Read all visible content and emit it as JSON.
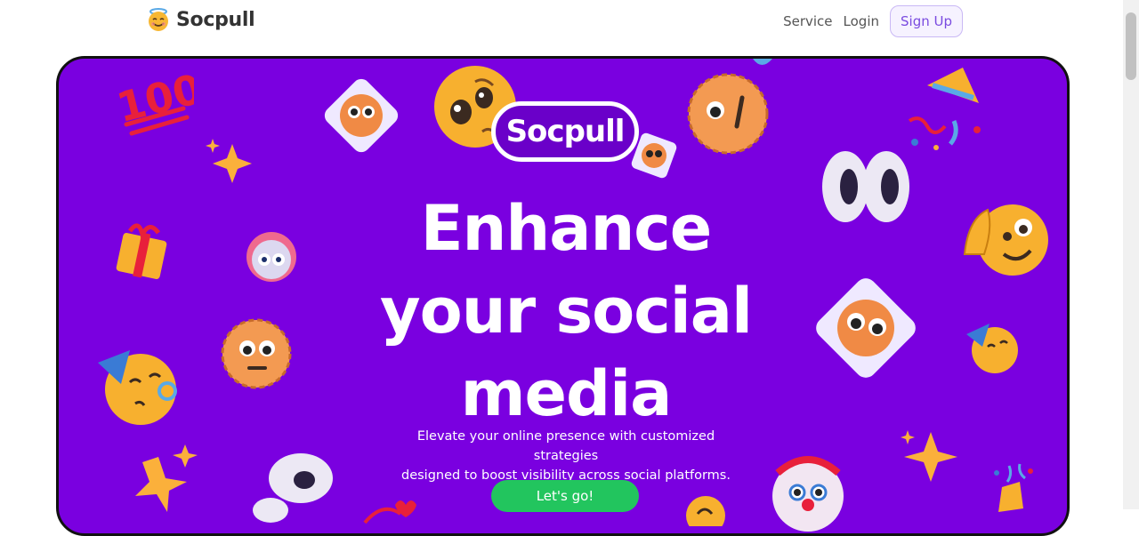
{
  "header": {
    "brand_name": "Socpull",
    "nav": {
      "service": "Service",
      "login": "Login",
      "signup": "Sign Up"
    }
  },
  "hero": {
    "logo_text": "Socpull",
    "headline_line1": "Enhance",
    "headline_line2": "your social",
    "headline_line3": "media",
    "subtitle_line1": "Elevate your online presence with customized strategies",
    "subtitle_line2": "designed to boost visibility across social platforms.",
    "cta_label": "Let's go!",
    "background_color": "#7a00e0",
    "cta_color": "#22c55e"
  },
  "decorations": [
    "hundred-points-icon",
    "sparkles-icon",
    "gift-icon",
    "partying-face-icon",
    "star-icon",
    "pleading-face-icon",
    "shocked-face-icon",
    "eyes-icon",
    "waving-smiley-icon",
    "party-popper-icon",
    "clown-face-icon",
    "robot-icon",
    "heart-icon"
  ]
}
